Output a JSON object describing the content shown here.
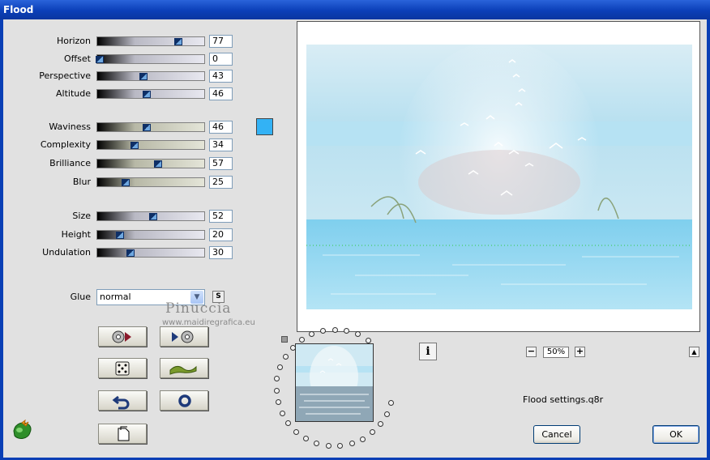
{
  "window": {
    "title": "Flood"
  },
  "sliders": [
    {
      "key": "horizon",
      "label": "Horizon",
      "value": 77,
      "style": "std"
    },
    {
      "key": "offset",
      "label": "Offset",
      "value": 0,
      "style": "std"
    },
    {
      "key": "perspective",
      "label": "Perspective",
      "value": 43,
      "style": "std"
    },
    {
      "key": "altitude",
      "label": "Altitude",
      "value": 46,
      "style": "std"
    },
    {
      "key": "waviness",
      "label": "Waviness",
      "value": 46,
      "style": "alt"
    },
    {
      "key": "complexity",
      "label": "Complexity",
      "value": 34,
      "style": "alt"
    },
    {
      "key": "brilliance",
      "label": "Brilliance",
      "value": 57,
      "style": "alt"
    },
    {
      "key": "blur",
      "label": "Blur",
      "value": 25,
      "style": "alt"
    },
    {
      "key": "size",
      "label": "Size",
      "value": 52,
      "style": "std"
    },
    {
      "key": "height",
      "label": "Height",
      "value": 20,
      "style": "std"
    },
    {
      "key": "undulation",
      "label": "Undulation",
      "value": 30,
      "style": "std"
    }
  ],
  "color_swatch": "#33b2f5",
  "glue": {
    "label": "Glue",
    "value": "normal",
    "s_button": "S"
  },
  "watermark": {
    "name": "Pinuccia",
    "url": "www.maidiregrafica.eu"
  },
  "tool_buttons": [
    {
      "name": "load-preset-button",
      "icon": "disc-play-icon"
    },
    {
      "name": "save-preset-button",
      "icon": "play-disc-icon"
    },
    {
      "name": "randomize-button",
      "icon": "dice-icon"
    },
    {
      "name": "wave-button",
      "icon": "wave-icon"
    },
    {
      "name": "undo-button",
      "icon": "undo-arrow-icon"
    },
    {
      "name": "reset-button",
      "icon": "ring-icon"
    },
    {
      "name": "copy-button",
      "icon": "document-icon"
    }
  ],
  "preview": {
    "zoom": "50%",
    "zoom_minus": "−",
    "zoom_plus": "+",
    "up": "▲",
    "info": "i"
  },
  "settings_file": "Flood settings.q8r",
  "buttons": {
    "cancel": "Cancel",
    "ok": "OK"
  }
}
